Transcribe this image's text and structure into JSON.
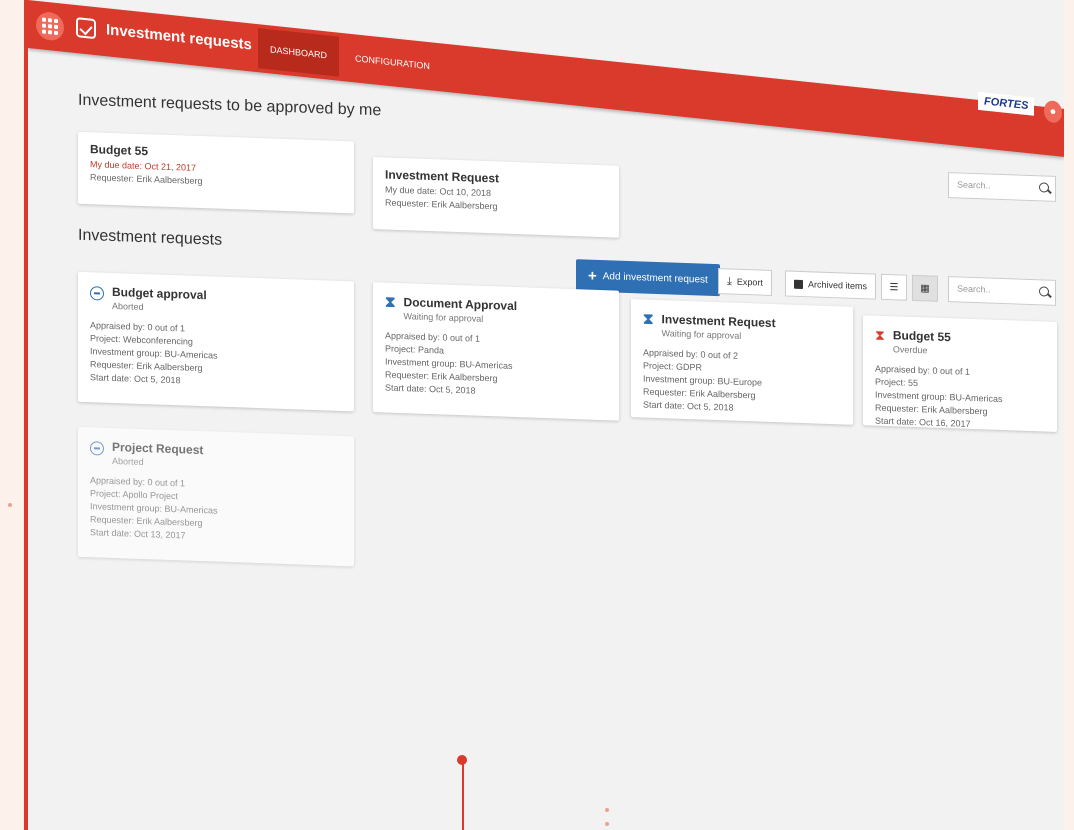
{
  "app": {
    "title": "Investment requests",
    "brand": "FORTES",
    "accent_color": "#d93a2b",
    "primary_button_color": "#2f6fb3",
    "tabs": [
      {
        "label": "DASHBOARD",
        "active": true
      },
      {
        "label": "CONFIGURATION",
        "active": false
      }
    ]
  },
  "approvals": {
    "heading": "Investment requests to be approved by me",
    "search_placeholder": "Search..",
    "cards": [
      {
        "title": "Budget 55",
        "due": "My due date: Oct 21, 2017",
        "requester": "Requester: Erik Aalbersberg",
        "overdue": true
      },
      {
        "title": "Investment Request",
        "due": "My due date: Oct 10, 2018",
        "requester": "Requester: Erik Aalbersberg",
        "overdue": false
      }
    ]
  },
  "requests": {
    "heading": "Investment requests",
    "add_label": "Add investment request",
    "export_label": "Export",
    "archived_label": "Archived items",
    "search_placeholder": "Search..",
    "cards": [
      {
        "title": "Budget approval",
        "status": "Aborted",
        "icon": "aborted-icon",
        "lines": [
          "Appraised by: 0 out of 1",
          "Project: Webconferencing",
          "Investment group: BU-Americas",
          "Requester: Erik Aalbersberg",
          "Start date: Oct 5, 2018"
        ]
      },
      {
        "title": "Document Approval",
        "status": "Waiting for approval",
        "icon": "hourglass-icon",
        "lines": [
          "Appraised by: 0 out of 1",
          "Project: Panda",
          "Investment group: BU-Americas",
          "Requester: Erik Aalbersberg",
          "Start date: Oct 5, 2018"
        ]
      },
      {
        "title": "Investment Request",
        "status": "Waiting for approval",
        "icon": "hourglass-icon",
        "lines": [
          "Appraised by: 0 out of 2",
          "Project: GDPR",
          "Investment group: BU-Europe",
          "Requester: Erik Aalbersberg",
          "Start date: Oct 5, 2018"
        ]
      },
      {
        "title": "Budget 55",
        "status": "Overdue",
        "icon": "hourglass-red-icon",
        "lines": [
          "Appraised by: 0 out of 1",
          "Project: 55",
          "Investment group: BU-Americas",
          "Requester: Erik Aalbersberg",
          "Start date: Oct 16, 2017"
        ]
      },
      {
        "title": "Project Request",
        "status": "Aborted",
        "icon": "aborted-icon",
        "lines": [
          "Appraised by: 0 out of 1",
          "Project: Apollo Project",
          "Investment group: BU-Americas",
          "Requester: Erik Aalbersberg",
          "Start date: Oct 13, 2017"
        ]
      }
    ]
  }
}
